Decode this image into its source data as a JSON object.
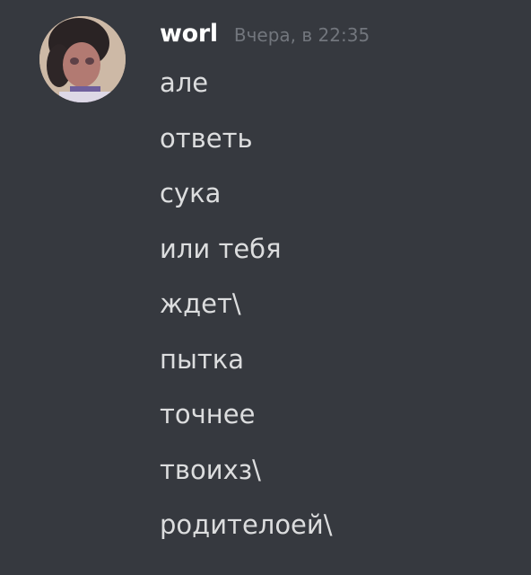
{
  "message_group": {
    "author": "worl",
    "timestamp": "Вчера, в 22:35",
    "avatar_icon": "user-avatar",
    "messages": [
      "але",
      "ответь",
      "сука",
      "или тебя",
      "ждет\\",
      "пытка",
      "точнее",
      "твоихз\\",
      "родителоей\\"
    ]
  },
  "colors": {
    "background": "#36393f",
    "username": "#ffffff",
    "timestamp": "#72767d",
    "message_text": "#dcddde"
  }
}
